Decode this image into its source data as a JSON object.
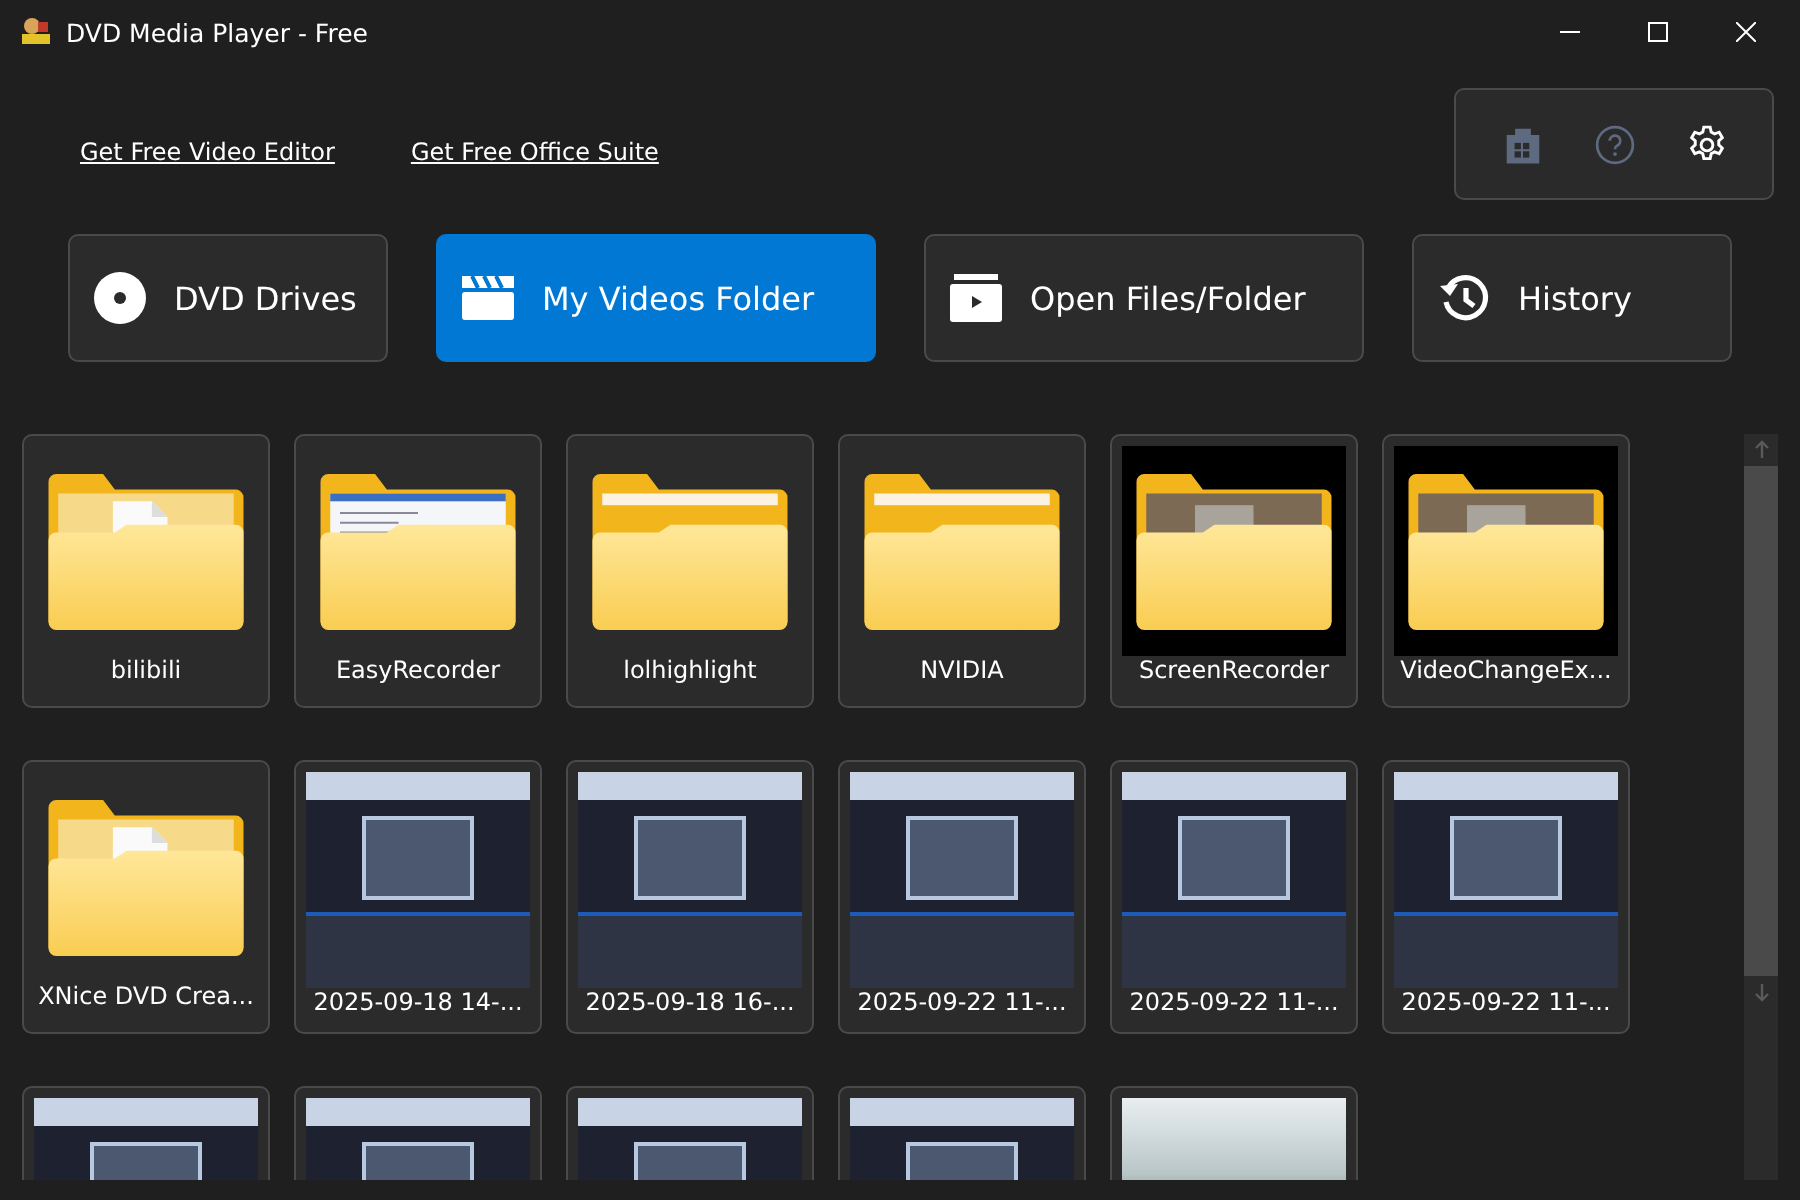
{
  "window": {
    "title": "DVD Media Player - Free"
  },
  "links": [
    "Get Free Video Editor",
    "Get Free Office Suite"
  ],
  "toolbar": [
    {
      "kind": "store",
      "disabled": true
    },
    {
      "kind": "help",
      "disabled": true
    },
    {
      "kind": "settings",
      "disabled": false
    }
  ],
  "nav": [
    {
      "kind": "disc",
      "label": "DVD Drives",
      "selected": false
    },
    {
      "kind": "clapper",
      "label": "My Videos Folder",
      "selected": true
    },
    {
      "kind": "open",
      "label": "Open Files/Folder",
      "selected": false
    },
    {
      "kind": "history",
      "label": "History",
      "selected": false
    }
  ],
  "items": [
    {
      "kind": "docfolder",
      "dark_backdrop": false,
      "label": "bilibili"
    },
    {
      "kind": "windowfolder",
      "dark_backdrop": false,
      "label": "EasyRecorder"
    },
    {
      "kind": "folder",
      "dark_backdrop": false,
      "label": "lolhighlight"
    },
    {
      "kind": "folder",
      "dark_backdrop": false,
      "label": "NVIDIA"
    },
    {
      "kind": "photofolder",
      "dark_backdrop": true,
      "label": "ScreenRecorder"
    },
    {
      "kind": "photofolder",
      "dark_backdrop": true,
      "label": "VideoChangeEx..."
    },
    {
      "kind": "docfolder",
      "dark_backdrop": false,
      "label": "XNice DVD Crea..."
    },
    {
      "kind": "video",
      "label": "2025-09-18 14-..."
    },
    {
      "kind": "video",
      "label": "2025-09-18 16-..."
    },
    {
      "kind": "video",
      "label": "2025-09-22 11-..."
    },
    {
      "kind": "video",
      "label": "2025-09-22 11-..."
    },
    {
      "kind": "video",
      "label": "2025-09-22 11-..."
    },
    {
      "kind": "video"
    },
    {
      "kind": "video"
    },
    {
      "kind": "video"
    },
    {
      "kind": "video"
    },
    {
      "kind": "image"
    }
  ]
}
